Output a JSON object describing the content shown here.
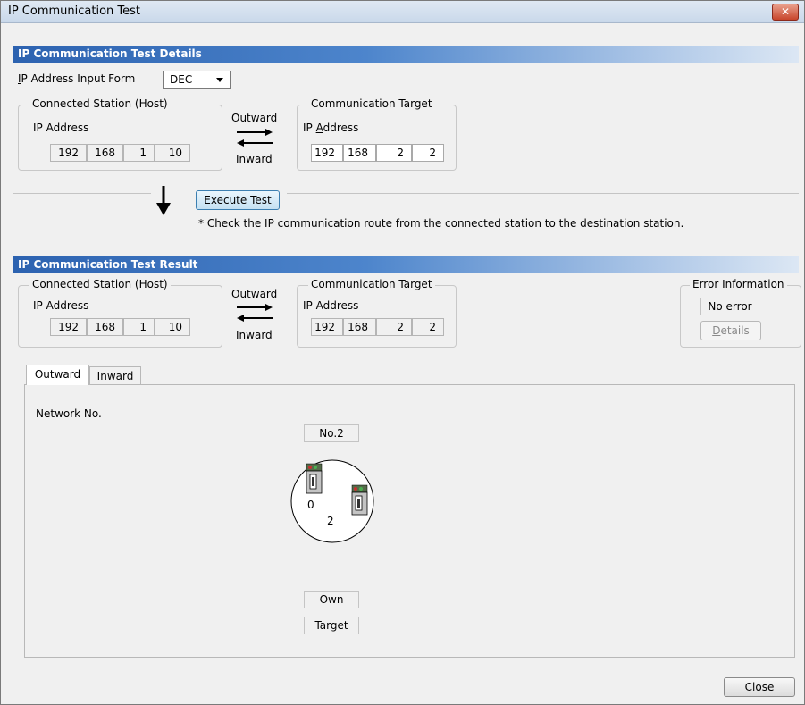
{
  "window": {
    "title": "IP Communication Test",
    "close_glyph": "✕"
  },
  "details": {
    "header": "IP Communication Test Details",
    "input_form_label": "IP Address Input Form",
    "input_form_value": "DEC",
    "host": {
      "legend": "Connected Station (Host)",
      "ip_label": "IP Address",
      "octets": [
        "192",
        "168",
        "1",
        "10"
      ]
    },
    "outward_label": "Outward",
    "inward_label": "Inward",
    "target": {
      "legend": "Communication Target",
      "ip_label_pre": "IP ",
      "ip_label_acc": "A",
      "ip_label_post": "ddress",
      "octets": [
        "192",
        "168",
        "2",
        "2"
      ]
    },
    "execute_button": "Execute Test",
    "note": "* Check the IP communication route from the connected station to the destination station."
  },
  "result": {
    "header": "IP Communication Test Result",
    "host": {
      "legend": "Connected Station (Host)",
      "ip_label": "IP Address",
      "octets": [
        "192",
        "168",
        "1",
        "10"
      ]
    },
    "outward_label": "Outward",
    "inward_label": "Inward",
    "target": {
      "legend": "Communication Target",
      "ip_label": "IP Address",
      "octets": [
        "192",
        "168",
        "2",
        "2"
      ]
    },
    "error": {
      "legend": "Error Information",
      "status": "No error",
      "details_acc": "D",
      "details_rest": "etails"
    }
  },
  "tabs": [
    {
      "label": "Outward",
      "active": true
    },
    {
      "label": "Inward",
      "active": false
    }
  ],
  "diagram": {
    "network_label": "Network No.",
    "network_no": "No.2",
    "own_station_no": "0",
    "target_station_no": "2",
    "legend_own": "Own",
    "legend_target": "Target"
  },
  "footer": {
    "close_button": "Close"
  }
}
